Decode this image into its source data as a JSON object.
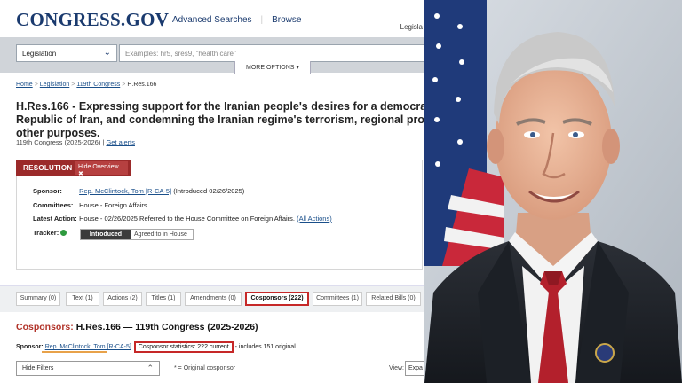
{
  "site": {
    "logo": "CONGRESS.GOV",
    "nav_advanced": "Advanced Searches",
    "nav_browse": "Browse",
    "account": "Legisla"
  },
  "search": {
    "scope": "Legislation",
    "placeholder": "Examples: hr5, sres9, \"health care\"",
    "more_options": "MORE OPTIONS ▾"
  },
  "breadcrumb": {
    "home": "Home",
    "legislation": "Legislation",
    "congress": "119th Congress",
    "current": "H.Res.166"
  },
  "bill": {
    "title_line1": "H.Res.166 - Expressing support for the Iranian people's desires for a democratic, s",
    "title_line2": "Republic of Iran, and condemning the Iranian regime's terrorism, regional proxy w",
    "title_line3": "other purposes.",
    "congress": "119th Congress (2025-2026)",
    "get_alerts": "Get alerts"
  },
  "overview": {
    "type_label": "RESOLUTION",
    "hide_label": "Hide Overview ✖",
    "sponsor_key": "Sponsor:",
    "sponsor_name": "Rep. McClintock, Tom [R-CA-5]",
    "sponsor_date": "(Introduced 02/26/2025)",
    "committees_key": "Committees:",
    "committees_val": "House - Foreign Affairs",
    "latest_key": "Latest Action:",
    "latest_val": "House - 02/26/2025 Referred to the House Committee on Foreign Affairs.",
    "all_actions": "(All Actions)",
    "tracker_key": "Tracker:",
    "tracker_step1": "Introduced",
    "tracker_step2": "Agreed to in House"
  },
  "tabs": [
    "Summary (0)",
    "Text (1)",
    "Actions (2)",
    "Titles (1)",
    "Amendments (0)",
    "Cosponsors (222)",
    "Committees (1)",
    "Related Bills (0)"
  ],
  "cosponsors": {
    "heading_red": "Cosponsors:",
    "heading_rest": "H.Res.166 — 119th Congress (2025-2026)",
    "sponsor_key": "Sponsor:",
    "sponsor_name": "Rep. McClintock, Tom [R-CA-5]",
    "stats": "Cosponsor statistics: 222 current",
    "includes": "- includes 151 original",
    "hide_filters": "Hide Filters",
    "original_note": "* = Original cosponsor",
    "view_label": "View:",
    "view_value": "Expa"
  },
  "colors": {
    "brand_navy": "#1a3a6e",
    "resolution_red": "#9b2a2a",
    "highlight_red": "#c62828",
    "underline_orange": "#e8a24a"
  }
}
